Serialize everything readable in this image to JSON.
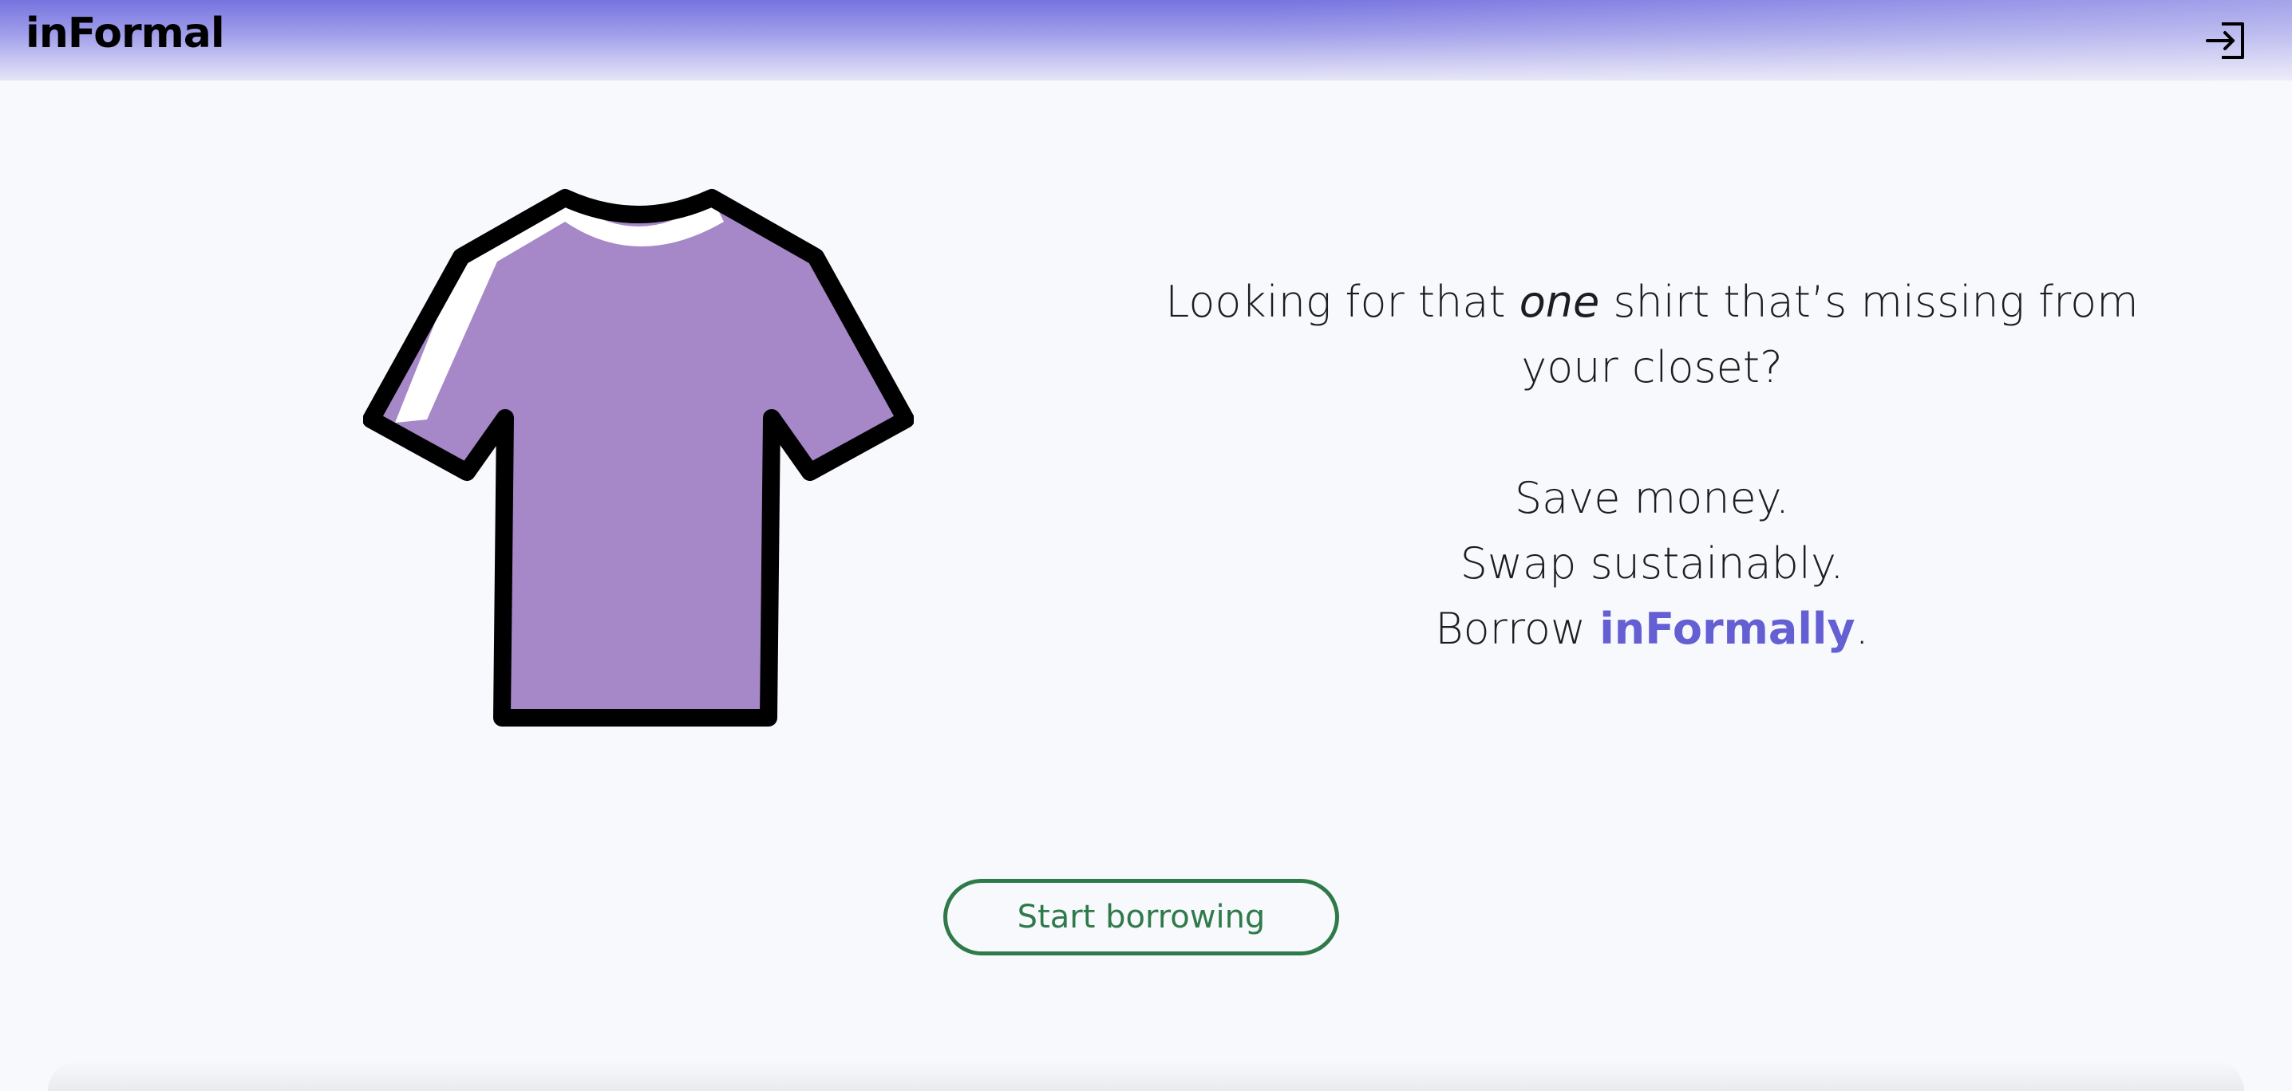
{
  "app": {
    "brand": "inFormal",
    "accent_color": "#6460d4",
    "cta_color": "#2f7a4a",
    "shirt_color": "#a688c8"
  },
  "header": {
    "logo_text": "inFormal",
    "login_icon": "sign-in-icon"
  },
  "hero": {
    "illustration": "t-shirt-icon",
    "line1_prefix": "Looking for that ",
    "line1_emphasis": "one",
    "line1_suffix": " shirt that’s missing from",
    "line2": "your closet?",
    "line3": "Save money.",
    "line4": "Swap sustainably.",
    "line5_prefix": "Borrow ",
    "line5_brand": "inFormally",
    "line5_suffix": "."
  },
  "cta": {
    "label": "Start borrowing"
  }
}
